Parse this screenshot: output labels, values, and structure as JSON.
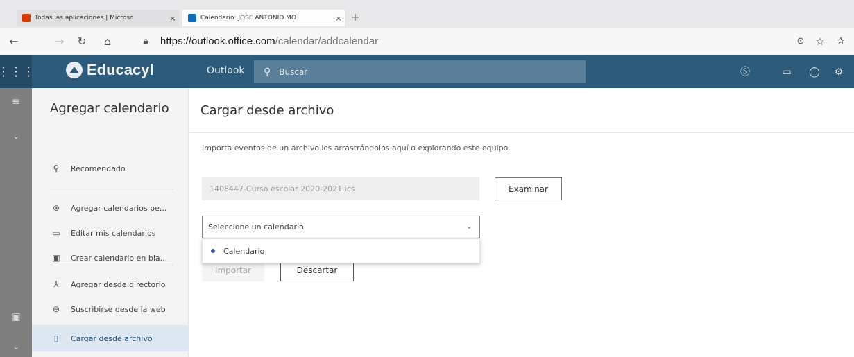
{
  "browser": {
    "tabs": [
      {
        "title": "Todas las aplicaciones | Microso",
        "favicon_color": "#d83b01"
      },
      {
        "title": "Calendario: JOSE ANTONIO MO",
        "favicon_color": "#0f6cbd"
      }
    ],
    "tab_close": "×",
    "new_tab": "+",
    "url_host": "https://outlook.office.com",
    "url_path": "/calendar/addcalendar"
  },
  "header": {
    "brand": "Educacyl",
    "app": "Outlook",
    "search_placeholder": "Buscar",
    "accent": "#2d5b7b"
  },
  "sidebar": {
    "title": "Agregar calendario",
    "items": [
      {
        "label": "Recomendado",
        "icon": "lightbulb-icon"
      },
      {
        "label": "Agregar calendarios pe...",
        "icon": "people-icon"
      },
      {
        "label": "Editar mis calendarios",
        "icon": "calendar-edit-icon"
      },
      {
        "label": "Crear calendario en bla...",
        "icon": "calendar-add-icon"
      },
      {
        "label": "Agregar desde directorio",
        "icon": "directory-icon"
      },
      {
        "label": "Suscribirse desde la web",
        "icon": "globe-icon"
      },
      {
        "label": "Cargar desde archivo",
        "icon": "file-icon"
      }
    ],
    "active_item": "Cargar desde archivo"
  },
  "main": {
    "title": "Cargar desde archivo",
    "description": "Importa eventos de un archivo.ics arrastrándolos aquí o explorando este equipo.",
    "file_value": "1408447-Curso escolar 2020-2021.ics",
    "browse_label": "Examinar",
    "select_placeholder": "Seleccione un calendario",
    "dropdown_options": [
      "Calendario"
    ],
    "import_label": "Importar",
    "discard_label": "Descartar"
  }
}
